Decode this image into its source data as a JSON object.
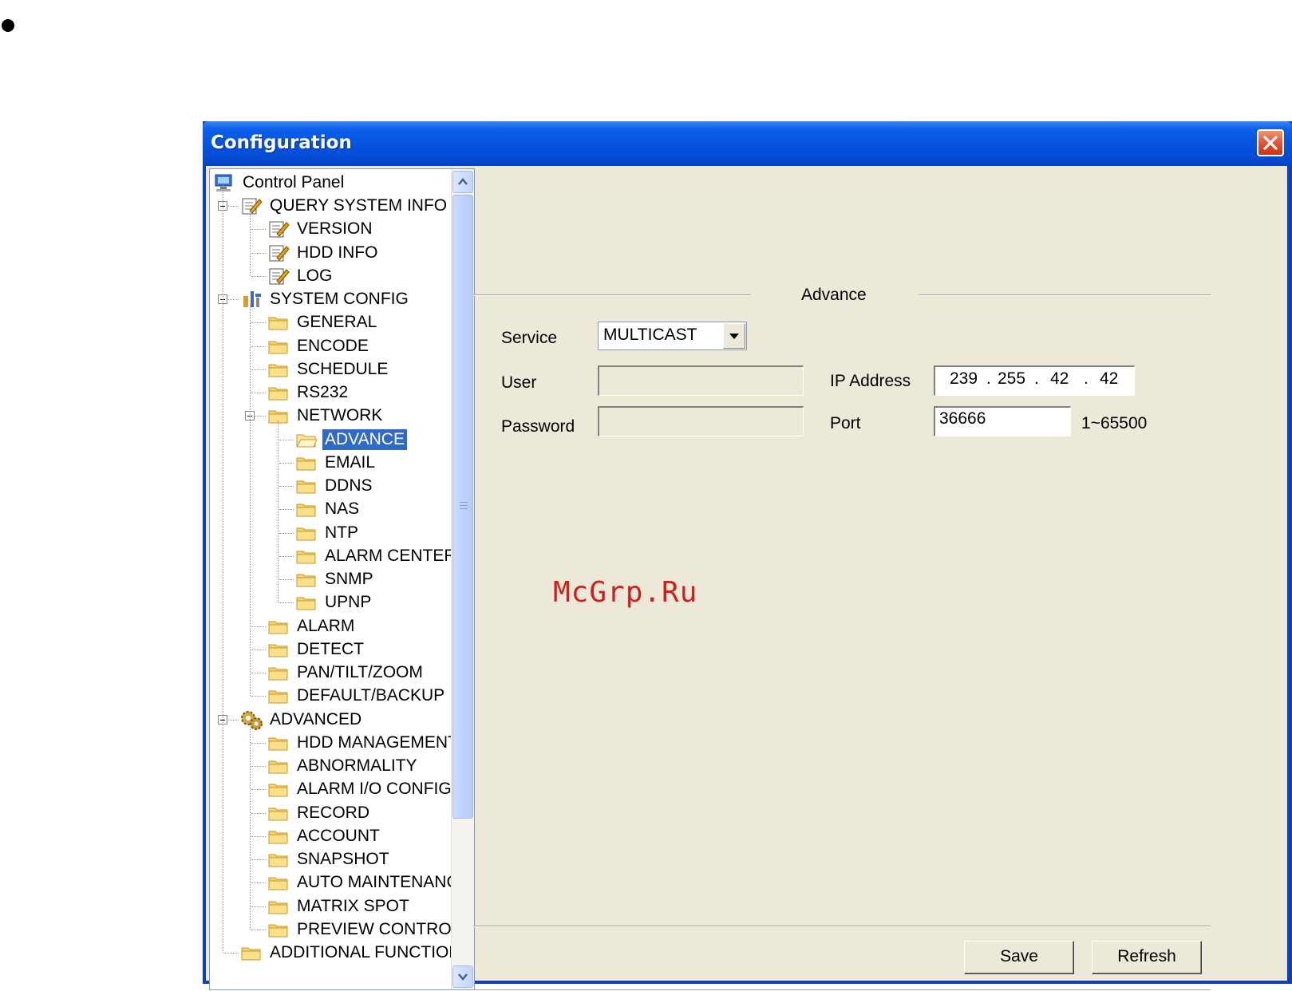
{
  "window": {
    "title": "Configuration"
  },
  "tree": {
    "root": "Control Panel",
    "items": [
      {
        "label": "QUERY SYSTEM INFO"
      },
      {
        "label": "VERSION"
      },
      {
        "label": "HDD INFO"
      },
      {
        "label": "LOG"
      },
      {
        "label": "SYSTEM CONFIG"
      },
      {
        "label": "GENERAL"
      },
      {
        "label": "ENCODE"
      },
      {
        "label": "SCHEDULE"
      },
      {
        "label": "RS232"
      },
      {
        "label": "NETWORK"
      },
      {
        "label": "ADVANCE",
        "selected": true
      },
      {
        "label": "EMAIL"
      },
      {
        "label": "DDNS"
      },
      {
        "label": "NAS"
      },
      {
        "label": "NTP"
      },
      {
        "label": "ALARM CENTER"
      },
      {
        "label": "SNMP"
      },
      {
        "label": "UPNP"
      },
      {
        "label": "ALARM"
      },
      {
        "label": "DETECT"
      },
      {
        "label": "PAN/TILT/ZOOM"
      },
      {
        "label": "DEFAULT/BACKUP"
      },
      {
        "label": "ADVANCED"
      },
      {
        "label": "HDD MANAGEMENT"
      },
      {
        "label": "ABNORMALITY"
      },
      {
        "label": "ALARM I/O CONFIG"
      },
      {
        "label": "RECORD"
      },
      {
        "label": "ACCOUNT"
      },
      {
        "label": "SNAPSHOT"
      },
      {
        "label": "AUTO MAINTENANCE"
      },
      {
        "label": "MATRIX SPOT"
      },
      {
        "label": "PREVIEW CONTROL"
      },
      {
        "label": "ADDITIONAL FUNCTION"
      }
    ]
  },
  "panel": {
    "group_title": "Advance",
    "service_label": "Service",
    "service_value": "MULTICAST",
    "user_label": "User",
    "user_value": "",
    "password_label": "Password",
    "password_value": "",
    "ip_label": "IP Address",
    "ip": [
      "239",
      "255",
      "42",
      "42"
    ],
    "ip_dot": ".",
    "port_label": "Port",
    "port_value": "36666",
    "port_range": "1~65500",
    "save_label": "Save",
    "refresh_label": "Refresh"
  },
  "watermark": "McGrp.Ru"
}
